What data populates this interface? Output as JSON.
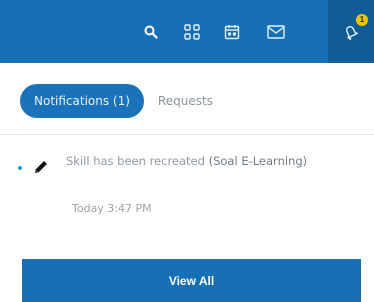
{
  "topbar": {
    "icons": [
      {
        "name": "search-icon"
      },
      {
        "name": "apps-grid-icon"
      },
      {
        "name": "calendar-icon"
      },
      {
        "name": "mail-icon"
      },
      {
        "name": "bell-icon",
        "active": true,
        "badge": "1"
      }
    ],
    "background": "#1570b5",
    "active_background": "#0f5c97",
    "badge_color": "#f2c200"
  },
  "tabs": [
    {
      "label": "Notifications (1)",
      "active": true
    },
    {
      "label": "Requests",
      "active": false
    }
  ],
  "notification": {
    "unread": true,
    "icon": "pencil-icon",
    "message": "Skill has been recreated",
    "tag": "(Soal E-Learning)",
    "time": "Today 3:47 PM"
  },
  "view_all_label": "View All",
  "accent": "#1570b5"
}
